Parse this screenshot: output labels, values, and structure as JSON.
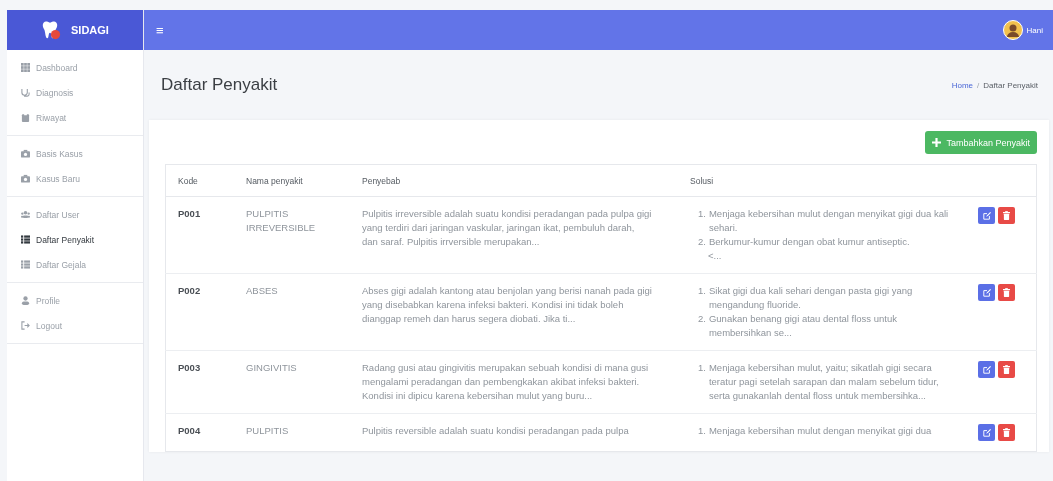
{
  "brand": {
    "name": "SIDAGI"
  },
  "header": {
    "menu_glyph": "≡",
    "user": "Hani"
  },
  "sidebar": {
    "groups": [
      {
        "items": [
          {
            "label": "Dashboard",
            "selected": false
          },
          {
            "label": "Diagnosis",
            "selected": false
          },
          {
            "label": "Riwayat",
            "selected": false
          }
        ]
      },
      {
        "items": [
          {
            "label": "Basis Kasus",
            "selected": false
          },
          {
            "label": "Kasus Baru",
            "selected": false
          }
        ]
      },
      {
        "items": [
          {
            "label": "Daftar User",
            "selected": false
          },
          {
            "label": "Daftar Penyakit",
            "selected": true
          },
          {
            "label": "Daftar Gejala",
            "selected": false
          }
        ]
      },
      {
        "items": [
          {
            "label": "Profile",
            "selected": false
          },
          {
            "label": "Logout",
            "selected": false
          }
        ]
      }
    ]
  },
  "page": {
    "title": "Daftar Penyakit",
    "breadcrumb": [
      {
        "label": "Home",
        "link": true
      },
      {
        "label": "Daftar Penyakit",
        "link": false
      }
    ],
    "breadcrumb_separator": "/"
  },
  "add_button": {
    "label": "Tambahkan Penyakit"
  },
  "table": {
    "columns": [
      "Kode",
      "Nama penyakit",
      "Penyebab",
      "Solusi"
    ],
    "rows": [
      {
        "kode": "P001",
        "nama": "PULPITIS IRREVERSIBLE",
        "penyebab": "Pulpitis irreversible adalah suatu kondisi peradangan pada pulpa gigi yang terdiri dari jaringan vaskular, jaringan ikat, pembuluh darah, dan saraf. Pulpitis irrversible merupakan...",
        "solusi": [
          {
            "number": "1.",
            "text": "Menjaga kebersihan mulut dengan menyikat gigi dua kali sehari."
          },
          {
            "number": "2.",
            "text": "Berkumur-kumur dengan obat kumur antiseptic."
          }
        ],
        "solusi_more": "<..."
      },
      {
        "kode": "P002",
        "nama": "ABSES",
        "penyebab": "Abses gigi adalah kantong atau benjolan yang berisi nanah pada gigi yang disebabkan karena infeksi bakteri. Kondisi ini tidak boleh dianggap remeh dan harus segera diobati. Jika ti...",
        "solusi": [
          {
            "number": "1.",
            "text": "Sikat gigi dua kali sehari dengan pasta gigi yang mengandung fluoride."
          },
          {
            "number": "2.",
            "text": "Gunakan benang gigi atau dental floss untuk membersihkan se..."
          }
        ]
      },
      {
        "kode": "P003",
        "nama": "GINGIVITIS",
        "penyebab": "Radang gusi atau gingivitis merupakan sebuah kondisi di mana gusi mengalami peradangan dan pembengkakan akibat infeksi bakteri. Kondisi ini dipicu karena kebersihan mulut yang buru...",
        "solusi": [
          {
            "number": "1.",
            "text": "Menjaga kebersihan mulut, yaitu; sikatlah gigi secara teratur pagi setelah sarapan dan malam sebelum tidur, serta gunakanlah dental floss untuk membersihka..."
          }
        ]
      },
      {
        "kode": "P004",
        "nama": "PULPITIS",
        "penyebab": "Pulpitis reversible adalah suatu kondisi peradangan pada pulpa",
        "solusi": [
          {
            "number": "1.",
            "text": "Menjaga kebersihan mulut dengan menyikat gigi dua"
          }
        ]
      }
    ]
  }
}
